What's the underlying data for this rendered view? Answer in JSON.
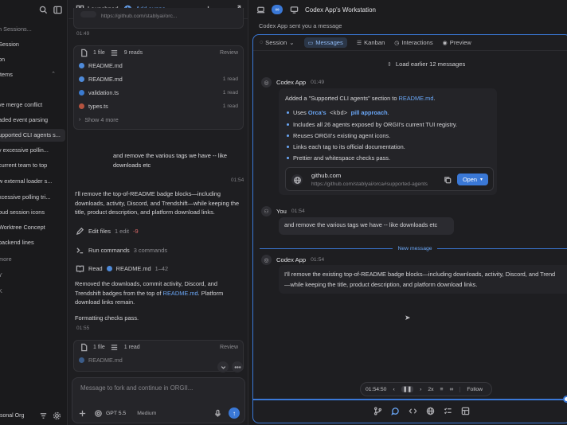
{
  "sidebar": {
    "items": [
      {
        "label": "h Sessions...",
        "dim": true
      },
      {
        "label": "Session"
      },
      {
        "label": "on"
      },
      {
        "label": "Items",
        "chevron": "chevron-updown-icon"
      },
      {
        "label": "ve merge conflict"
      },
      {
        "label": "aded event parsing"
      },
      {
        "label": "upported CLI agents s...",
        "selected": true
      },
      {
        "label": "y excessive pollin..."
      },
      {
        "label": "current team to top"
      },
      {
        "label": "w external loader s..."
      },
      {
        "label": "xcessive polling tri..."
      },
      {
        "label": "oud session icons"
      },
      {
        "label": "Worktree Concept"
      },
      {
        "label": "backend lines"
      },
      {
        "label": "more",
        "dim": true
      },
      {
        "label": "Y",
        "dim": true
      },
      {
        "label": "K",
        "dim": true
      }
    ],
    "footer_label": "sonal Org",
    "icons": [
      "search-icon",
      "sidebar-toggle-icon",
      "filter-icon",
      "gear-icon"
    ]
  },
  "middle": {
    "tabs": [
      {
        "label": "Launchpad",
        "icon": "grid-icon"
      },
      {
        "label": "Add suppo...",
        "icon": "globe-icon",
        "active": true
      }
    ],
    "top_card_url": "https://github.com/stablyai/orc...",
    "top_time": "01:49",
    "files_card_1": {
      "summary": "1 file",
      "reads": "9 reads",
      "review": "Review",
      "rows": [
        {
          "name": "README.md",
          "meta": "",
          "color": "#4e8ad9"
        },
        {
          "name": "README.md",
          "meta": "1 read",
          "color": "#4e8ad9"
        },
        {
          "name": "validation.ts",
          "meta": "1 read",
          "color": "#3b7bd0"
        },
        {
          "name": "types.ts",
          "meta": "1 read",
          "color": "#b4533f"
        }
      ],
      "show_more": "Show 4 more"
    },
    "user_msg": "and remove the various tags we have -- like downloads etc",
    "user_time": "01:54",
    "assistant_text": "I'll remove the top-of-README badge blocks—including downloads, activity, Discord, and Trendshift—while keeping the title, product description, and platform download links.",
    "edit": {
      "label": "Edit files",
      "count": "1 edit",
      "delta": "-9"
    },
    "run": {
      "label": "Run commands",
      "count": "3 commands"
    },
    "read": {
      "label": "Read",
      "file": "README.md",
      "range": "1–42"
    },
    "removed_text_prefix": "Removed the downloads, commit activity, Discord, and Trendshift badges from the top of ",
    "removed_link": "README.md",
    "removed_text_suffix": ". Platform download links remain.",
    "checks_text": "Formatting checks pass.",
    "checks_time": "01:55",
    "files_card_2": {
      "summary": "1 file",
      "reads": "1 read",
      "review": "Review",
      "row": "README.md"
    },
    "composer": {
      "placeholder": "Message to fork and continue in ORGII...",
      "model": "GPT 5.5",
      "effort": "Medium"
    }
  },
  "right": {
    "title": "Codex App's Workstation",
    "notice": "Codex App sent you a message",
    "tabs": [
      {
        "label": "Session",
        "icon": "chat-icon"
      },
      {
        "label": "Messages",
        "icon": "messages-icon",
        "active": true
      },
      {
        "label": "Kanban",
        "icon": "kanban-icon"
      },
      {
        "label": "Interactions",
        "icon": "clock-icon"
      },
      {
        "label": "Preview",
        "icon": "eye-icon"
      }
    ],
    "load_earlier": "Load earlier 12 messages",
    "msg1": {
      "author": "Codex App",
      "time": "01:49",
      "intro_prefix": "Added a \"Supported CLI agents\" section to ",
      "intro_link": "README.md",
      "intro_suffix": ".",
      "bullets": [
        {
          "parts": [
            "Uses ",
            "Orca's",
            " <kbd> ",
            "pill approach",
            "."
          ]
        },
        {
          "text": "Includes all 26 agents exposed by ORGII's current TUI registry."
        },
        {
          "text": "Reuses ORGII's existing agent icons."
        },
        {
          "text": "Links each tag to its official documentation."
        },
        {
          "text": "Prettier and whitespace checks pass."
        }
      ],
      "link_card": {
        "title": "github.com",
        "url": "https://github.com/stablyai/orca#supported-agents",
        "button": "Open"
      }
    },
    "msg2": {
      "author": "You",
      "time": "01:54",
      "text": "and remove the various tags we have -- like downloads etc"
    },
    "new_message_label": "New message",
    "msg3": {
      "author": "Codex App",
      "time": "01:54",
      "line1": "I'll remove the existing top-of-README badge blocks—including downloads, activity, Discord, and Trend",
      "line2": "—while keeping the title, product description, and platform download links."
    },
    "player": {
      "time": "01:54:50",
      "speed": "2x",
      "follow": "Follow"
    }
  }
}
